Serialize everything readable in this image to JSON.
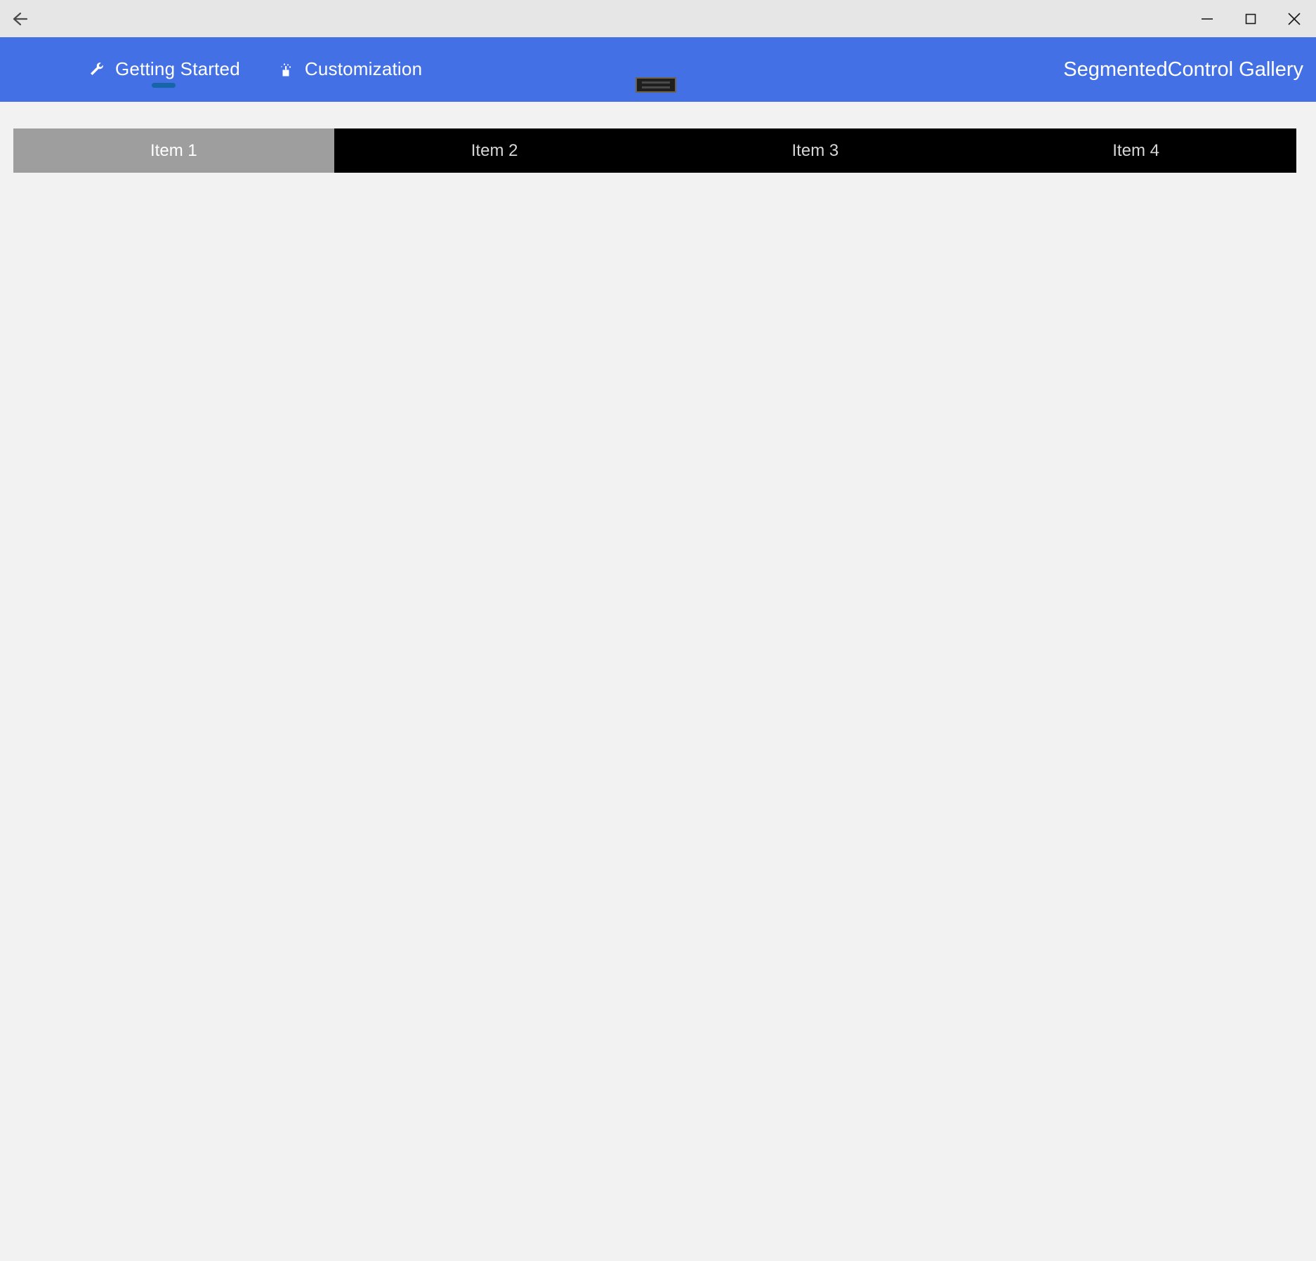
{
  "window": {
    "back_label": "Back",
    "controls": {
      "minimize_label": "Minimize",
      "maximize_label": "Maximize",
      "close_label": "Close"
    }
  },
  "appbar": {
    "title": "SegmentedControl Gallery",
    "background_color": "#4470e5",
    "underline_color": "#1565a8",
    "tabs": [
      {
        "label": "Getting Started",
        "icon": "wrench-icon",
        "selected": true
      },
      {
        "label": "Customization",
        "icon": "paint-sparkle-icon",
        "selected": false
      }
    ],
    "handle": {
      "name": "drag-handle",
      "lines": 2,
      "color": "#1f1f1f",
      "border_color": "#6e6147"
    }
  },
  "content": {
    "segmented_control": {
      "selected_index": 0,
      "selected_color": "#9e9e9e",
      "unselected_color": "#000000",
      "selected_text_color": "#ffffff",
      "unselected_text_color": "#d6d6d6",
      "segments": [
        {
          "label": "Item 1"
        },
        {
          "label": "Item 2"
        },
        {
          "label": "Item 3"
        },
        {
          "label": "Item 4"
        }
      ]
    },
    "background_color": "#f2f2f2"
  }
}
